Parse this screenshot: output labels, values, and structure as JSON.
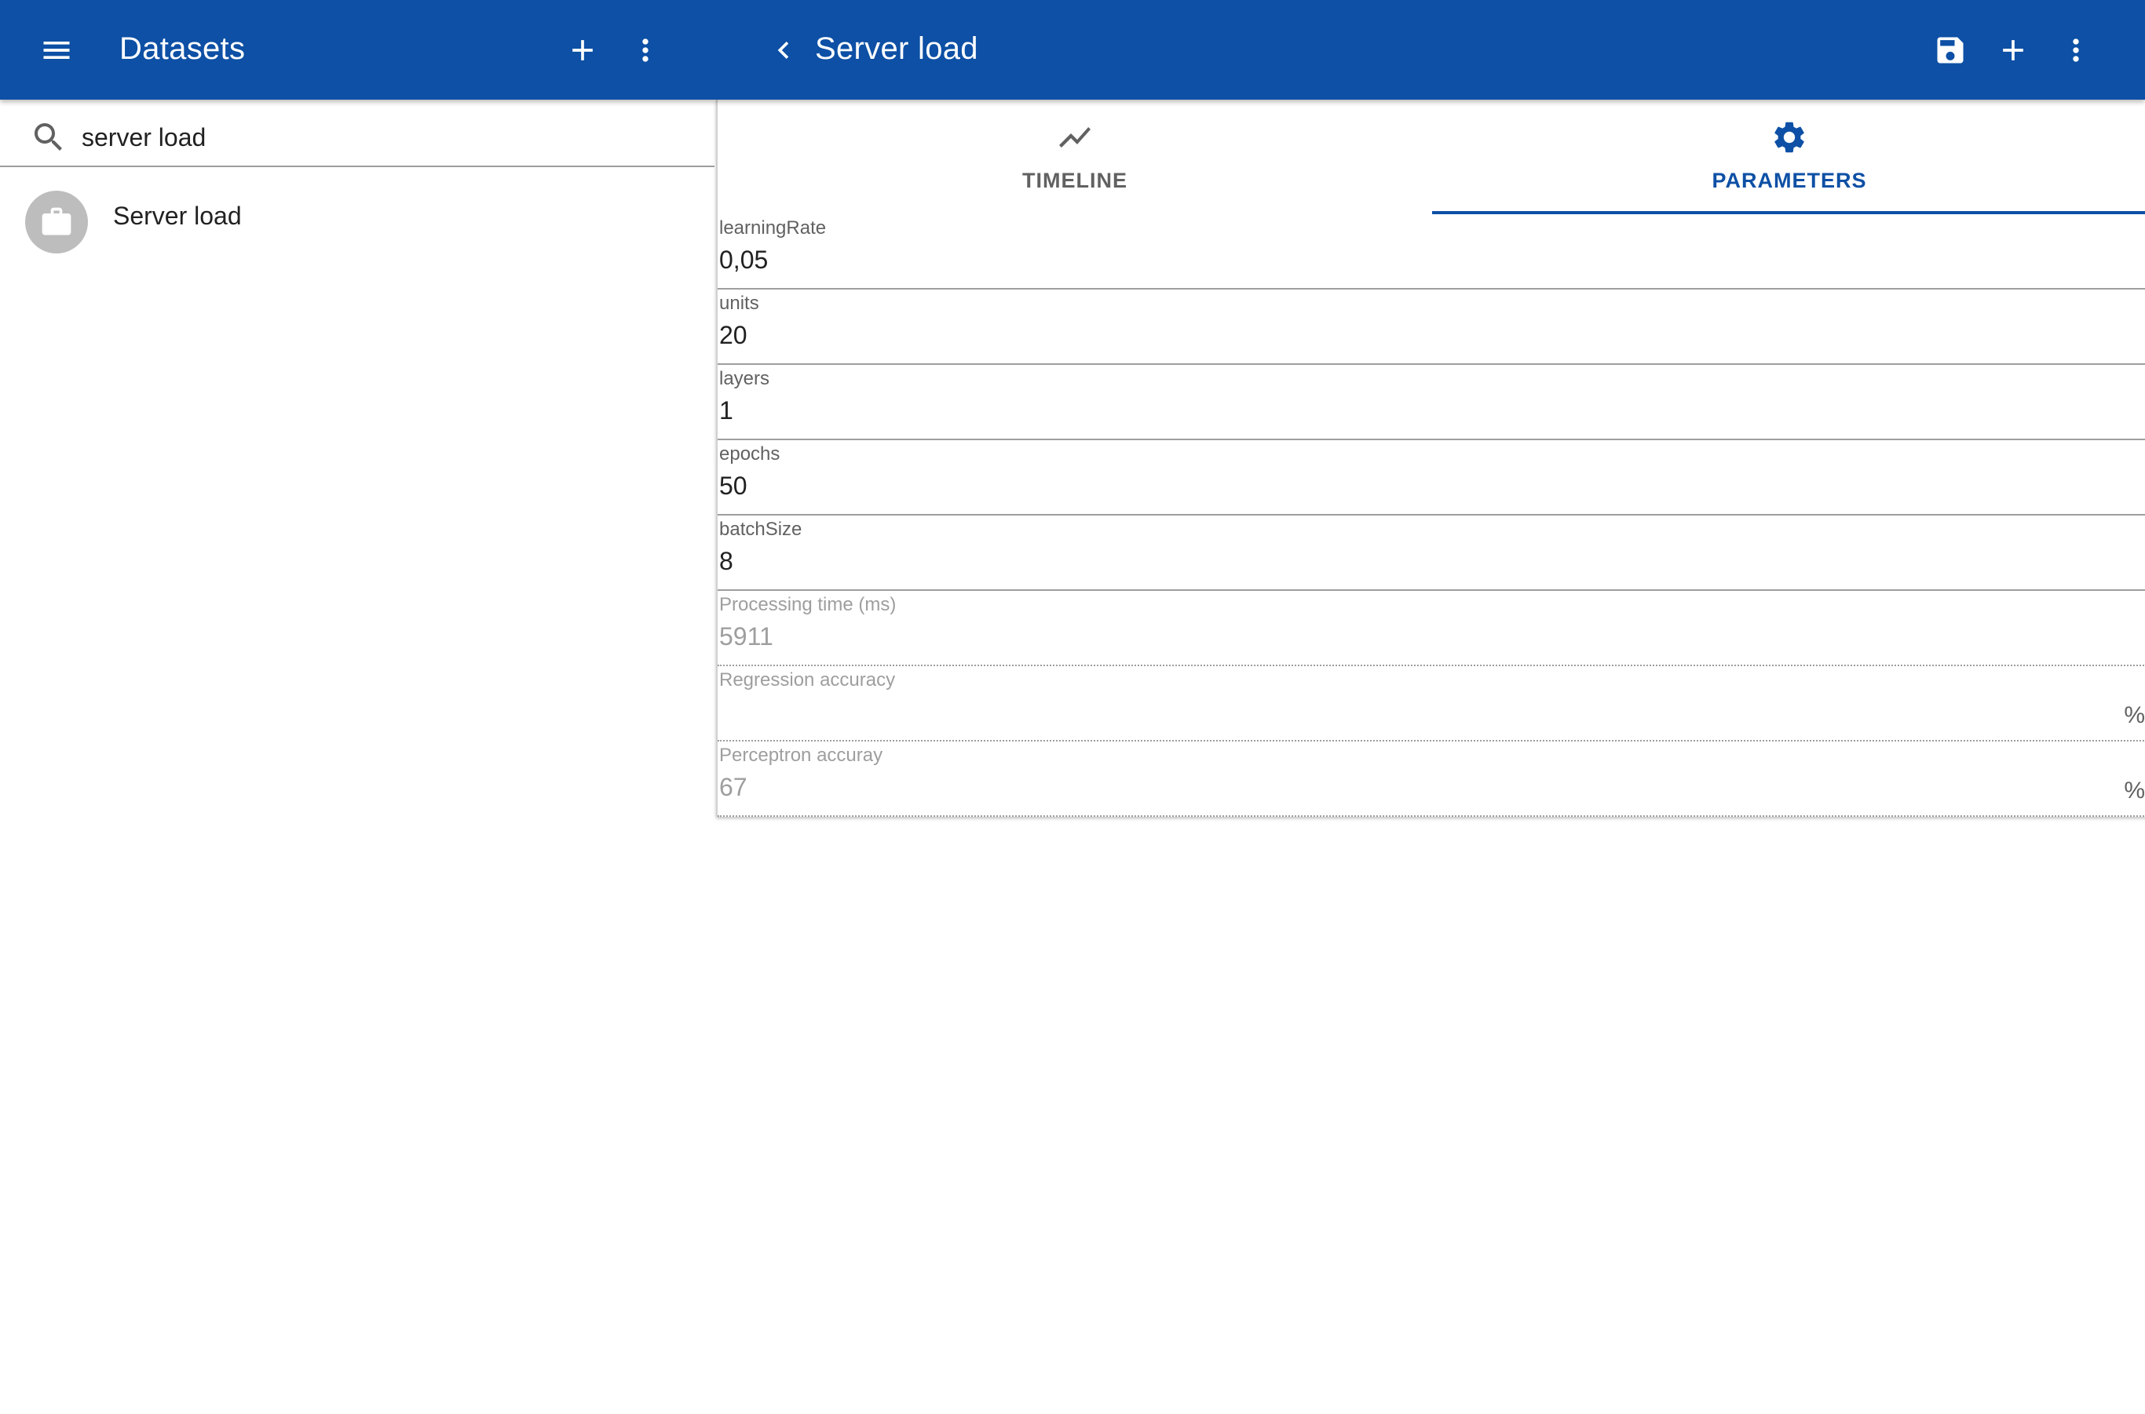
{
  "left_bar": {
    "menu_icon": "menu-icon",
    "title": "Datasets",
    "add_icon": "add-icon",
    "more_icon": "more-vert-icon"
  },
  "right_bar": {
    "back_icon": "chevron-left-icon",
    "title": "Server load",
    "save_icon": "save-icon",
    "add_icon": "add-icon",
    "more_icon": "more-vert-icon"
  },
  "search": {
    "icon": "search-icon",
    "value": "server load"
  },
  "list": {
    "items": [
      {
        "label": "Server load",
        "icon": "briefcase-icon"
      }
    ]
  },
  "tabs": [
    {
      "label": "TIMELINE",
      "icon": "timeline-icon",
      "active": false
    },
    {
      "label": "PARAMETERS",
      "icon": "gear-icon",
      "active": true
    }
  ],
  "fields": [
    {
      "label": "learningRate",
      "value": "0,05",
      "editable": true
    },
    {
      "label": "units",
      "value": "20",
      "editable": true
    },
    {
      "label": "layers",
      "value": "1",
      "editable": true
    },
    {
      "label": "epochs",
      "value": "50",
      "editable": true
    },
    {
      "label": "batchSize",
      "value": "8",
      "editable": true
    },
    {
      "label": "Processing time (ms)",
      "value": "5911",
      "editable": false
    },
    {
      "label": "Regression accuracy",
      "value": "",
      "suffix": "%",
      "editable": false
    },
    {
      "label": "Perceptron accuray",
      "value": "67",
      "suffix": "%",
      "editable": false
    }
  ],
  "colors": {
    "primary": "#0d50a5",
    "app_bar_text": "#ffffff",
    "inactive_tab": "#616161",
    "avatar_bg": "#bdbdbd",
    "disabled_text": "#9e9e9e"
  }
}
